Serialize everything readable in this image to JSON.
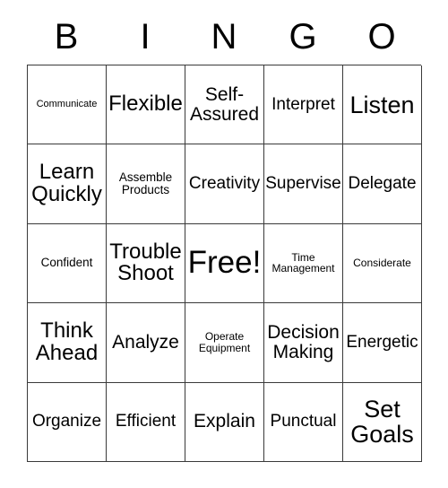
{
  "card": {
    "title": "BINGO",
    "headers": [
      "B",
      "I",
      "N",
      "G",
      "O"
    ],
    "free_space_label": "Free!",
    "colors": {
      "background": "#ffffff",
      "border": "#3a3a3a",
      "text": "#000000"
    },
    "rows": [
      [
        {
          "text": "Communicate",
          "size": "s-xs"
        },
        {
          "text": "Flexible",
          "size": "s-xxl"
        },
        {
          "text": "Self-\nAssured",
          "size": "s-xl"
        },
        {
          "text": "Interpret",
          "size": "s-lg"
        },
        {
          "text": "Listen",
          "size": "s-huge"
        }
      ],
      [
        {
          "text": "Learn\nQuickly",
          "size": "s-xxl"
        },
        {
          "text": "Assemble\nProducts",
          "size": "s-md"
        },
        {
          "text": "Creativity",
          "size": "s-lg"
        },
        {
          "text": "Supervise",
          "size": "s-lg"
        },
        {
          "text": "Delegate",
          "size": "s-lg"
        }
      ],
      [
        {
          "text": "Confident",
          "size": "s-md"
        },
        {
          "text": "Trouble\nShoot",
          "size": "s-xxl"
        },
        {
          "text": "Free!",
          "size": "s-free"
        },
        {
          "text": "Time\nManagement",
          "size": "s-sm"
        },
        {
          "text": "Considerate",
          "size": "s-sm"
        }
      ],
      [
        {
          "text": "Think\nAhead",
          "size": "s-xxl"
        },
        {
          "text": "Analyze",
          "size": "s-xl"
        },
        {
          "text": "Operate\nEquipment",
          "size": "s-sm"
        },
        {
          "text": "Decision\nMaking",
          "size": "s-xl"
        },
        {
          "text": "Energetic",
          "size": "s-lg"
        }
      ],
      [
        {
          "text": "Organize",
          "size": "s-lg"
        },
        {
          "text": "Efficient",
          "size": "s-lg"
        },
        {
          "text": "Explain",
          "size": "s-xl"
        },
        {
          "text": "Punctual",
          "size": "s-lg"
        },
        {
          "text": "Set\nGoals",
          "size": "s-huge"
        }
      ]
    ]
  }
}
